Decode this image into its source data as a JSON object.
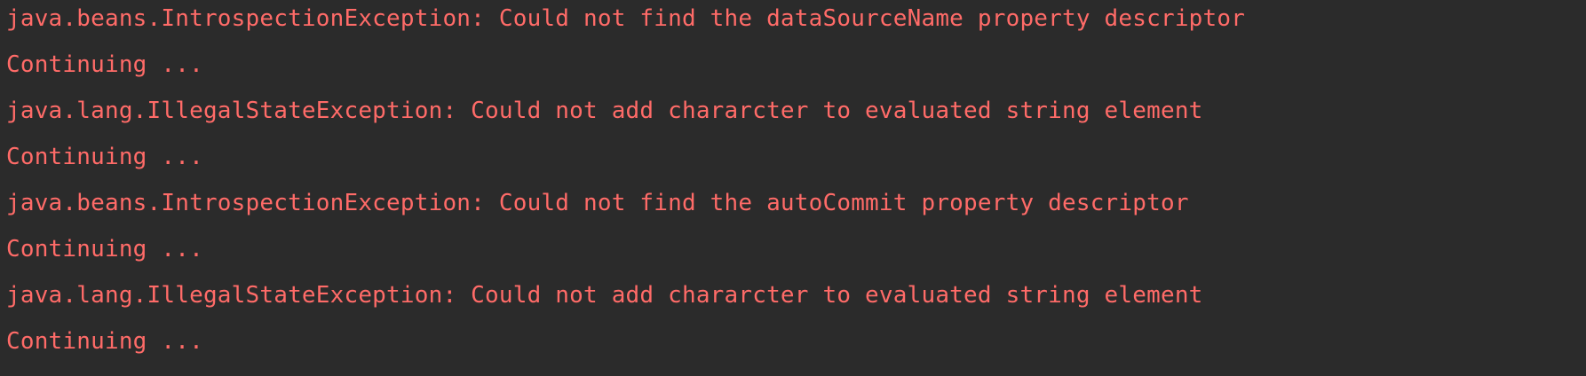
{
  "console": {
    "text_color": "#ff6b68",
    "background": "#2b2b2b",
    "lines": [
      "java.beans.IntrospectionException: Could not find the dataSourceName property descriptor",
      "Continuing ...",
      "java.lang.IllegalStateException: Could not add chararcter to evaluated string element",
      "Continuing ...",
      "java.beans.IntrospectionException: Could not find the autoCommit property descriptor",
      "Continuing ...",
      "java.lang.IllegalStateException: Could not add chararcter to evaluated string element",
      "Continuing ..."
    ]
  }
}
